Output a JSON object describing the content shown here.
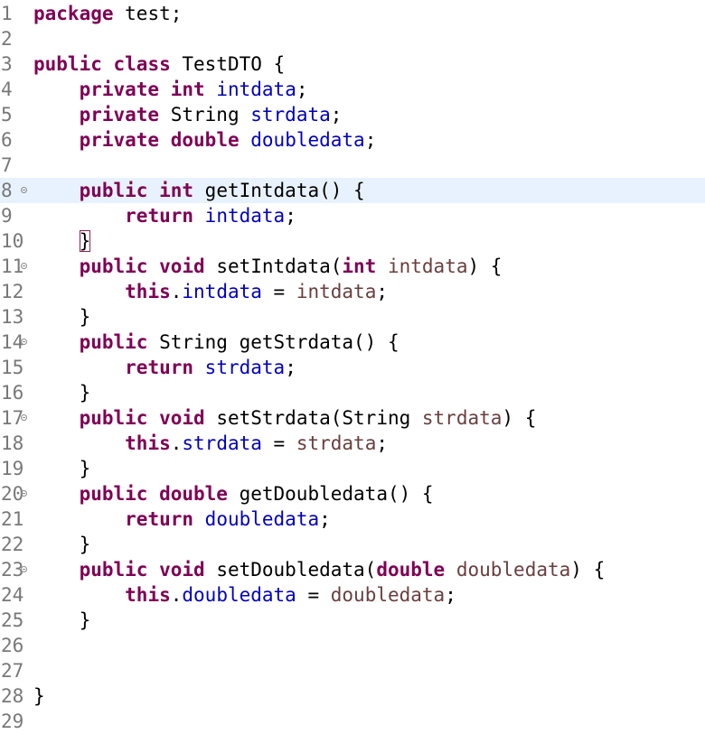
{
  "editor": {
    "current_line": 8,
    "matched_bracket_line": 10,
    "lines": [
      {
        "num": "1",
        "fold": false,
        "indent": "",
        "tokens": [
          [
            "kw",
            "package"
          ],
          [
            "pl",
            " test;"
          ]
        ]
      },
      {
        "num": "2",
        "fold": false,
        "indent": "",
        "tokens": []
      },
      {
        "num": "3",
        "fold": false,
        "indent": "",
        "tokens": [
          [
            "kw",
            "public"
          ],
          [
            "pl",
            " "
          ],
          [
            "kw",
            "class"
          ],
          [
            "pl",
            " TestDTO {"
          ]
        ]
      },
      {
        "num": "4",
        "fold": false,
        "indent": "    ",
        "tokens": [
          [
            "kw",
            "private"
          ],
          [
            "pl",
            " "
          ],
          [
            "kw",
            "int"
          ],
          [
            "pl",
            " "
          ],
          [
            "fld",
            "intdata"
          ],
          [
            "pl",
            ";"
          ]
        ]
      },
      {
        "num": "5",
        "fold": false,
        "indent": "    ",
        "tokens": [
          [
            "kw",
            "private"
          ],
          [
            "pl",
            " String "
          ],
          [
            "fld",
            "strdata"
          ],
          [
            "pl",
            ";"
          ]
        ]
      },
      {
        "num": "6",
        "fold": false,
        "indent": "    ",
        "tokens": [
          [
            "kw",
            "private"
          ],
          [
            "pl",
            " "
          ],
          [
            "kw",
            "double"
          ],
          [
            "pl",
            " "
          ],
          [
            "fld",
            "doubledata"
          ],
          [
            "pl",
            ";"
          ]
        ]
      },
      {
        "num": "7",
        "fold": false,
        "indent": "",
        "tokens": []
      },
      {
        "num": "8",
        "fold": true,
        "indent": "    ",
        "tokens": [
          [
            "kw",
            "public"
          ],
          [
            "pl",
            " "
          ],
          [
            "kw",
            "int"
          ],
          [
            "pl",
            " getIntdata() {"
          ]
        ]
      },
      {
        "num": "9",
        "fold": false,
        "indent": "        ",
        "tokens": [
          [
            "kw",
            "return"
          ],
          [
            "pl",
            " "
          ],
          [
            "fld",
            "intdata"
          ],
          [
            "pl",
            ";"
          ]
        ]
      },
      {
        "num": "10",
        "fold": false,
        "indent": "    ",
        "tokens": [
          [
            "brk",
            "}"
          ]
        ]
      },
      {
        "num": "11",
        "fold": true,
        "indent": "    ",
        "tokens": [
          [
            "kw",
            "public"
          ],
          [
            "pl",
            " "
          ],
          [
            "kw",
            "void"
          ],
          [
            "pl",
            " setIntdata("
          ],
          [
            "kw",
            "int"
          ],
          [
            "pl",
            " "
          ],
          [
            "prm",
            "intdata"
          ],
          [
            "pl",
            ") {"
          ]
        ]
      },
      {
        "num": "12",
        "fold": false,
        "indent": "        ",
        "tokens": [
          [
            "kw",
            "this"
          ],
          [
            "pl",
            "."
          ],
          [
            "fld",
            "intdata"
          ],
          [
            "pl",
            " = "
          ],
          [
            "prm",
            "intdata"
          ],
          [
            "pl",
            ";"
          ]
        ]
      },
      {
        "num": "13",
        "fold": false,
        "indent": "    ",
        "tokens": [
          [
            "pl",
            "}"
          ]
        ]
      },
      {
        "num": "14",
        "fold": true,
        "indent": "    ",
        "tokens": [
          [
            "kw",
            "public"
          ],
          [
            "pl",
            " String getStrdata() {"
          ]
        ]
      },
      {
        "num": "15",
        "fold": false,
        "indent": "        ",
        "tokens": [
          [
            "kw",
            "return"
          ],
          [
            "pl",
            " "
          ],
          [
            "fld",
            "strdata"
          ],
          [
            "pl",
            ";"
          ]
        ]
      },
      {
        "num": "16",
        "fold": false,
        "indent": "    ",
        "tokens": [
          [
            "pl",
            "}"
          ]
        ]
      },
      {
        "num": "17",
        "fold": true,
        "indent": "    ",
        "tokens": [
          [
            "kw",
            "public"
          ],
          [
            "pl",
            " "
          ],
          [
            "kw",
            "void"
          ],
          [
            "pl",
            " setStrdata(String "
          ],
          [
            "prm",
            "strdata"
          ],
          [
            "pl",
            ") {"
          ]
        ]
      },
      {
        "num": "18",
        "fold": false,
        "indent": "        ",
        "tokens": [
          [
            "kw",
            "this"
          ],
          [
            "pl",
            "."
          ],
          [
            "fld",
            "strdata"
          ],
          [
            "pl",
            " = "
          ],
          [
            "prm",
            "strdata"
          ],
          [
            "pl",
            ";"
          ]
        ]
      },
      {
        "num": "19",
        "fold": false,
        "indent": "    ",
        "tokens": [
          [
            "pl",
            "}"
          ]
        ]
      },
      {
        "num": "20",
        "fold": true,
        "indent": "    ",
        "tokens": [
          [
            "kw",
            "public"
          ],
          [
            "pl",
            " "
          ],
          [
            "kw",
            "double"
          ],
          [
            "pl",
            " getDoubledata() {"
          ]
        ]
      },
      {
        "num": "21",
        "fold": false,
        "indent": "        ",
        "tokens": [
          [
            "kw",
            "return"
          ],
          [
            "pl",
            " "
          ],
          [
            "fld",
            "doubledata"
          ],
          [
            "pl",
            ";"
          ]
        ]
      },
      {
        "num": "22",
        "fold": false,
        "indent": "    ",
        "tokens": [
          [
            "pl",
            "}"
          ]
        ]
      },
      {
        "num": "23",
        "fold": true,
        "indent": "    ",
        "tokens": [
          [
            "kw",
            "public"
          ],
          [
            "pl",
            " "
          ],
          [
            "kw",
            "void"
          ],
          [
            "pl",
            " setDoubledata("
          ],
          [
            "kw",
            "double"
          ],
          [
            "pl",
            " "
          ],
          [
            "prm",
            "doubledata"
          ],
          [
            "pl",
            ") {"
          ]
        ]
      },
      {
        "num": "24",
        "fold": false,
        "indent": "        ",
        "tokens": [
          [
            "kw",
            "this"
          ],
          [
            "pl",
            "."
          ],
          [
            "fld",
            "doubledata"
          ],
          [
            "pl",
            " = "
          ],
          [
            "prm",
            "doubledata"
          ],
          [
            "pl",
            ";"
          ]
        ]
      },
      {
        "num": "25",
        "fold": false,
        "indent": "    ",
        "tokens": [
          [
            "pl",
            "}"
          ]
        ]
      },
      {
        "num": "26",
        "fold": false,
        "indent": "",
        "tokens": []
      },
      {
        "num": "27",
        "fold": false,
        "indent": "",
        "tokens": []
      },
      {
        "num": "28",
        "fold": false,
        "indent": "",
        "tokens": [
          [
            "pl",
            "}"
          ]
        ]
      },
      {
        "num": "29",
        "fold": false,
        "indent": "",
        "tokens": []
      }
    ]
  },
  "colors": {
    "keyword": "#7f0055",
    "field": "#0000c0",
    "parameter": "#6a3e3e",
    "plain": "#000000",
    "line_number": "#787878",
    "current_line_bg": "#e8f2fe"
  }
}
